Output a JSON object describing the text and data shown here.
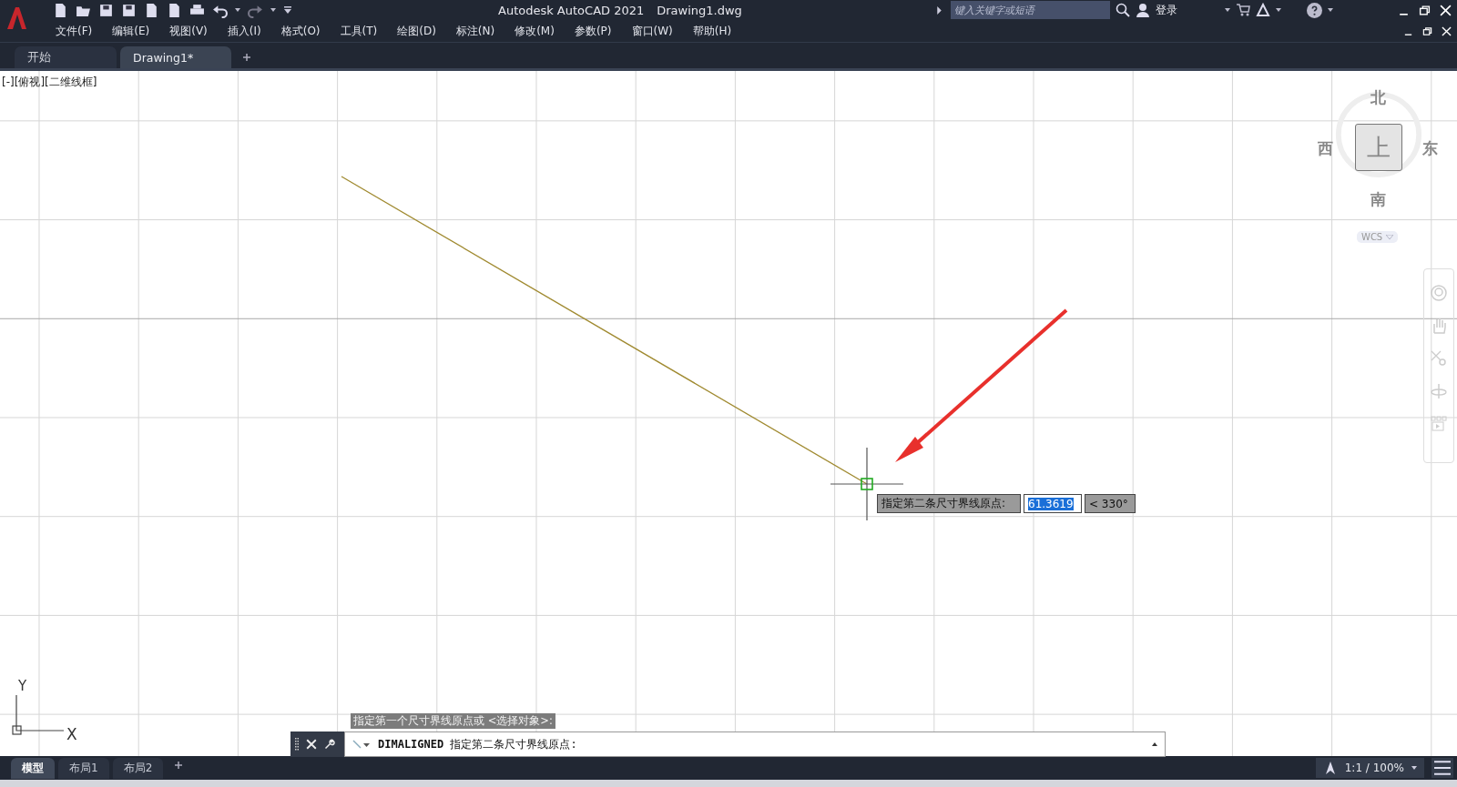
{
  "window": {
    "title": "Autodesk AutoCAD 2021",
    "file": "Drawing1.dwg"
  },
  "search": {
    "placeholder": "键入关键字或短语"
  },
  "user": {
    "label": "登录"
  },
  "menu": [
    "文件(F)",
    "编辑(E)",
    "视图(V)",
    "插入(I)",
    "格式(O)",
    "工具(T)",
    "绘图(D)",
    "标注(N)",
    "修改(M)",
    "参数(P)",
    "窗口(W)",
    "帮助(H)"
  ],
  "doc_tabs": [
    {
      "label": "开始",
      "selected": false
    },
    {
      "label": "Drawing1*",
      "selected": true
    }
  ],
  "viewport_label": "[-][俯视][二维线框]",
  "viewcube": {
    "north": "北",
    "south": "南",
    "east": "东",
    "west": "西",
    "face": "上",
    "wcs": "WCS"
  },
  "ucs": {
    "x": "X",
    "y": "Y"
  },
  "dynamic_input": {
    "prompt": "指定第二条尺寸界线原点:",
    "value": "61.3619",
    "angle": "< 330°"
  },
  "command_history": "指定第一个尺寸界线原点或 <选择对象>:",
  "command_line": {
    "command": "DIMALIGNED",
    "prompt": "指定第二条尺寸界线原点:"
  },
  "layout_tabs": [
    {
      "label": "模型",
      "selected": true
    },
    {
      "label": "布局1",
      "selected": false
    },
    {
      "label": "布局2",
      "selected": false
    }
  ],
  "status": {
    "scale": "1:1 / 100%"
  }
}
